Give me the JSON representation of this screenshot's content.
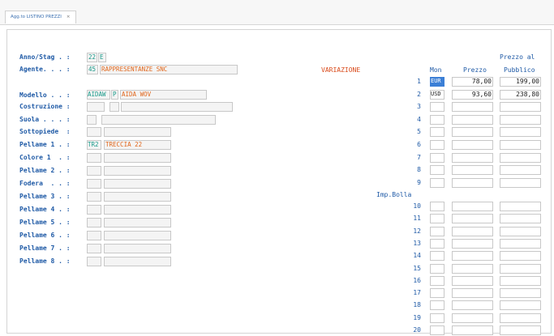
{
  "tab": {
    "title": "Agg.to LISTINO PREZZI",
    "close": "×"
  },
  "form": {
    "anno_label": "Anno/Stag . :",
    "anno_value": "22",
    "stag_value": "E",
    "agente_label": "Agente. . . :",
    "agente_code": "45",
    "agente_name": "RAPPRESENTANZE SNC",
    "variazione": "VARIAZIONE",
    "modello_label": "Modello . . :",
    "modello_code": "AIDAW",
    "modello_flag": "P",
    "modello_name": "AIDA WOV",
    "costruzione_label": "Costruzione :",
    "suola_label": "Suola . . . :",
    "sottopiede_label": "Sottopiede  :",
    "pellame1_label": "Pellame 1 . :",
    "pellame1_code": "TR2",
    "pellame1_name": "TRECCIA 22",
    "colore1_label": "Colore 1  . :",
    "pellame2_label": "Pellame 2 . :",
    "fodera_label": "Fodera  . . :",
    "pellame3_label": "Pellame 3 . :",
    "pellame4_label": "Pellame 4 . :",
    "pellame5_label": "Pellame 5 . :",
    "pellame6_label": "Pellame 6 . :",
    "pellame7_label": "Pellame 7 . :",
    "pellame8_label": "Pellame 8 . :"
  },
  "price_table": {
    "hdr_mon": "Mon",
    "hdr_prezzo": "Prezzo",
    "hdr_prezzo_al": "Prezzo al",
    "hdr_pubblico": "Pubblico",
    "imp_bolla": "Imp.Bolla",
    "rows": [
      {
        "n": "1",
        "mon": "EUR",
        "prezzo": "78,00",
        "pubblico": "199,00"
      },
      {
        "n": "2",
        "mon": "USD",
        "prezzo": "93,60",
        "pubblico": "238,80"
      },
      {
        "n": "3",
        "mon": "",
        "prezzo": "",
        "pubblico": ""
      },
      {
        "n": "4",
        "mon": "",
        "prezzo": "",
        "pubblico": ""
      },
      {
        "n": "5",
        "mon": "",
        "prezzo": "",
        "pubblico": ""
      },
      {
        "n": "6",
        "mon": "",
        "prezzo": "",
        "pubblico": ""
      },
      {
        "n": "7",
        "mon": "",
        "prezzo": "",
        "pubblico": ""
      },
      {
        "n": "8",
        "mon": "",
        "prezzo": "",
        "pubblico": ""
      },
      {
        "n": "9",
        "mon": "",
        "prezzo": "",
        "pubblico": ""
      },
      {
        "n": "10",
        "mon": "",
        "prezzo": "",
        "pubblico": ""
      },
      {
        "n": "11",
        "mon": "",
        "prezzo": "",
        "pubblico": ""
      },
      {
        "n": "12",
        "mon": "",
        "prezzo": "",
        "pubblico": ""
      },
      {
        "n": "13",
        "mon": "",
        "prezzo": "",
        "pubblico": ""
      },
      {
        "n": "14",
        "mon": "",
        "prezzo": "",
        "pubblico": ""
      },
      {
        "n": "15",
        "mon": "",
        "prezzo": "",
        "pubblico": ""
      },
      {
        "n": "16",
        "mon": "",
        "prezzo": "",
        "pubblico": ""
      },
      {
        "n": "17",
        "mon": "",
        "prezzo": "",
        "pubblico": ""
      },
      {
        "n": "18",
        "mon": "",
        "prezzo": "",
        "pubblico": ""
      },
      {
        "n": "19",
        "mon": "",
        "prezzo": "",
        "pubblico": ""
      },
      {
        "n": "20",
        "mon": "",
        "prezzo": "",
        "pubblico": ""
      }
    ]
  },
  "colors": {
    "label": "#1f5aa6",
    "code": "#1a9a8a",
    "name": "#e0651a",
    "selected": "#3b7fd6"
  }
}
